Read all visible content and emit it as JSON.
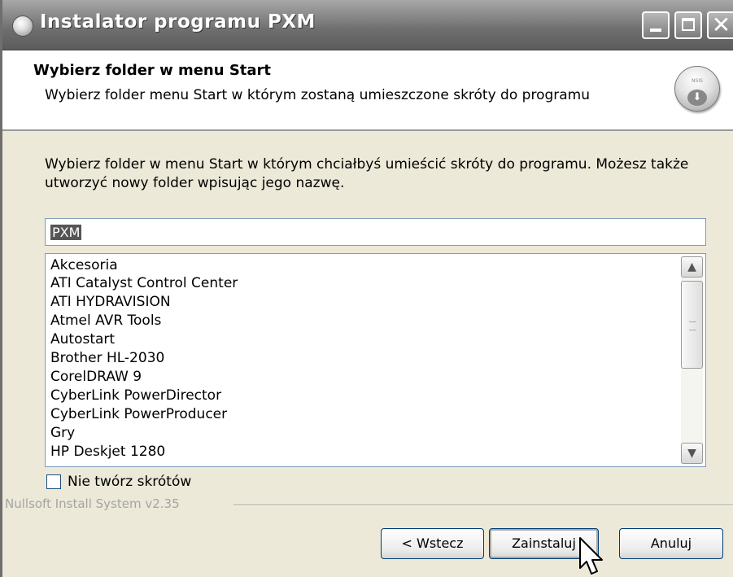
{
  "window": {
    "title": "Instalator programu PXM",
    "controls": [
      "minimize",
      "maximize",
      "close"
    ]
  },
  "header": {
    "title": "Wybierz folder w menu Start",
    "subtitle": "Wybierz folder menu Start w którym zostaną umieszczone skróty do programu",
    "logo_text": "NSIS"
  },
  "main": {
    "description": "Wybierz folder w menu Start w którym chciałbyś umieścić skróty do programu. Możesz także utworzyć nowy folder wpisując jego nazwę.",
    "folder_input_value": "PXM",
    "folder_list": [
      "Akcesoria",
      "ATI Catalyst Control Center",
      "ATI HYDRAVISION",
      "Atmel AVR Tools",
      "Autostart",
      "Brother HL-2030",
      "CorelDRAW 9",
      "CyberLink PowerDirector",
      "CyberLink PowerProducer",
      "Gry",
      "HP Deskjet 1280"
    ],
    "checkbox_label": "Nie twórz skrótów",
    "checkbox_checked": false
  },
  "footer": {
    "branding": "Nullsoft Install System v2.35",
    "back_label": "< Wstecz",
    "install_label": "Zainstaluj",
    "cancel_label": "Anuluj"
  },
  "icons": {
    "title_icon": "installer-icon",
    "header_logo": "nsis-logo-icon",
    "scroll_up": "chevron-up-icon",
    "scroll_down": "chevron-down-icon",
    "cursor": "mouse-pointer-icon"
  },
  "colors": {
    "titlebar": "#6e6e6e",
    "face": "#ece9d8",
    "border": "#7f9db9"
  }
}
